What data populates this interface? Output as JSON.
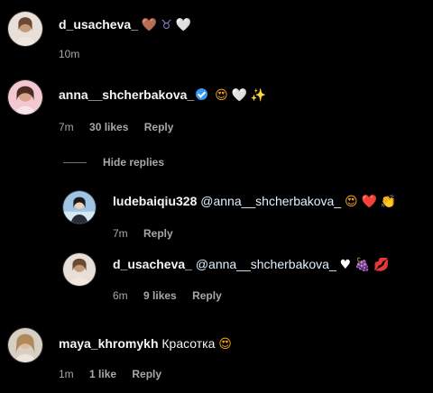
{
  "comments": [
    {
      "username": "d_usacheva_",
      "text": "",
      "emojis": [
        "🤎",
        "♉",
        "🤍"
      ],
      "time": "10m",
      "likes": "",
      "reply": ""
    },
    {
      "username": "anna__shcherbakova_",
      "verified": true,
      "text": "",
      "emojis": [
        "😍",
        "🤍",
        "✨"
      ],
      "time": "7m",
      "likes": "30 likes",
      "reply": "Reply"
    },
    {
      "username": "maya_khromykh",
      "text": "Красотка",
      "emojis": [
        "😍"
      ],
      "time": "1m",
      "likes": "1 like",
      "reply": "Reply"
    }
  ],
  "hide_replies_label": "Hide replies",
  "replies": [
    {
      "username": "ludebaiqiu328",
      "mention": "@anna__shcherbakova_",
      "emojis": [
        "😍",
        "❤️",
        "👏"
      ],
      "time": "7m",
      "likes": "",
      "reply": "Reply"
    },
    {
      "username": "d_usacheva_",
      "mention": "@anna__shcherbakova_",
      "emojis": [
        "♥",
        "🍇",
        "💋"
      ],
      "time": "6m",
      "likes": "9 likes",
      "reply": "Reply"
    }
  ],
  "colors": {
    "background": "#000000",
    "text": "#f5f5f5",
    "meta": "#a8a8a8",
    "verified": "#3897f0",
    "mention": "#e0f1ff"
  }
}
